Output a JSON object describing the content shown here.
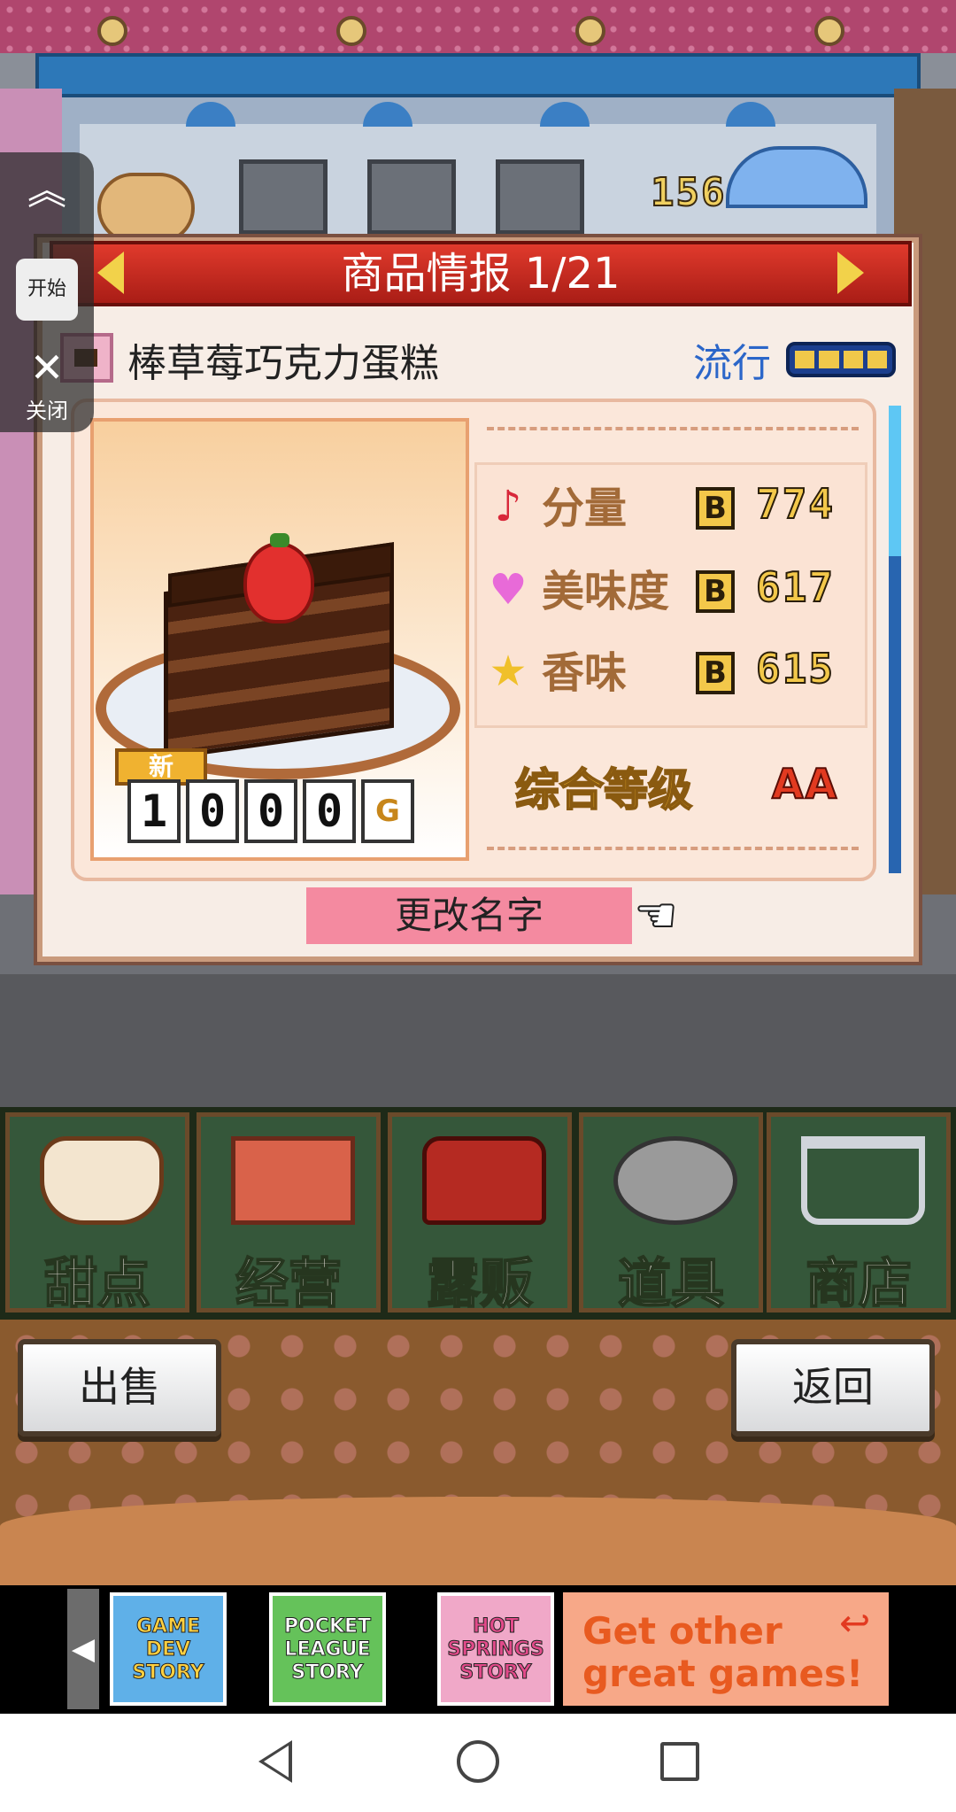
{
  "scene": {
    "money_counter": "156"
  },
  "float_widget": {
    "start_label": "开始",
    "close_label": "关闭"
  },
  "dialog": {
    "title": "商品情报 1/21",
    "product_name": "棒草莓巧克力蛋糕",
    "trend_label": "流行",
    "trend_level": 4,
    "trend_max": 4,
    "new_badge": "新",
    "price_digits": [
      "1",
      "0",
      "0",
      "0"
    ],
    "price_unit": "G",
    "stats": [
      {
        "label": "分量",
        "icon": "music-note-icon",
        "grade": "B",
        "value": "774"
      },
      {
        "label": "美味度",
        "icon": "heart-icon",
        "grade": "B",
        "value": "617"
      },
      {
        "label": "香味",
        "icon": "star-icon",
        "grade": "B",
        "value": "615"
      }
    ],
    "overall_label": "综合等级",
    "overall_grade": "AA",
    "rename_label": "更改名字"
  },
  "menu": {
    "items": [
      {
        "label": "甜点",
        "icon": "cake-icon"
      },
      {
        "label": "经营",
        "icon": "shop-icon"
      },
      {
        "label": "露贩",
        "icon": "food-truck-icon"
      },
      {
        "label": "道具",
        "icon": "items-icon"
      },
      {
        "label": "商店",
        "icon": "cart-icon"
      }
    ]
  },
  "buttons": {
    "sell_label": "出售",
    "back_label": "返回"
  },
  "ad": {
    "games": [
      {
        "title": "GAME DEV STORY"
      },
      {
        "title": "POCKET LEAGUE STORY"
      },
      {
        "title": "HOT SPRINGS STORY"
      }
    ],
    "cta_line1": "Get other",
    "cta_line2": "great games!"
  },
  "colors": {
    "header_red": "#c4261c",
    "trend_blue": "#2b66c9",
    "menu_green": "#35573a",
    "rename_pink": "#f48aa0",
    "grade_gold": "#f3c84a"
  }
}
